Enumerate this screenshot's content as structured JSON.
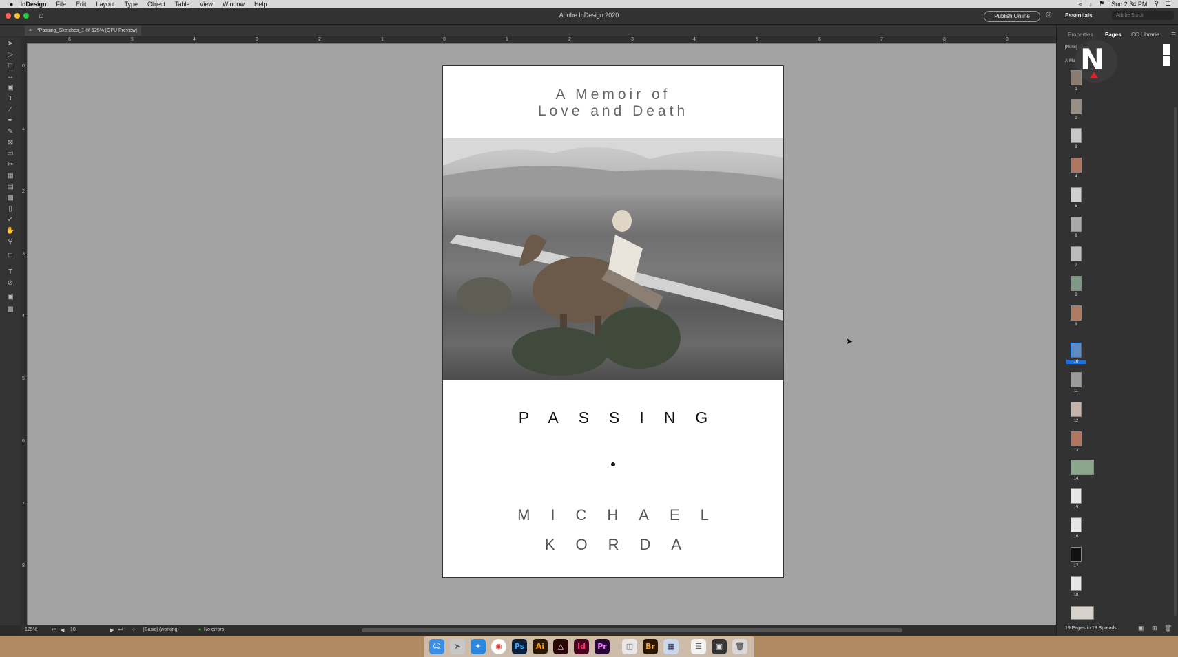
{
  "menubar": {
    "apple": "",
    "app_name": "InDesign",
    "items": [
      "File",
      "Edit",
      "Layout",
      "Type",
      "Object",
      "Table",
      "View",
      "Window",
      "Help"
    ],
    "clock": "Sun 2:34 PM"
  },
  "appbar": {
    "title": "Adobe InDesign 2020",
    "publish_label": "Publish Online",
    "workspace": "Essentials",
    "stock_placeholder": "Adobe Stock"
  },
  "document": {
    "tab_label": "*Passing_Sketches_1 @ 125% [GPU Preview]",
    "close_glyph": "×"
  },
  "rulers": {
    "top_ticks": [
      "6",
      "5",
      "4",
      "3",
      "2",
      "1",
      "0",
      "1",
      "2",
      "3",
      "4",
      "5",
      "6",
      "7",
      "8",
      "9"
    ],
    "left_ticks": [
      "0",
      "1",
      "2",
      "3",
      "4",
      "5",
      "6",
      "7",
      "8"
    ]
  },
  "cover": {
    "subtitle_line1": "A Memoir of",
    "subtitle_line2": "Love and Death",
    "title": "PASSING",
    "author_first": "MICHAEL",
    "author_last": "KORDA"
  },
  "statusbar": {
    "zoom": "125%",
    "page": "10",
    "profile": "[Basic] (working)",
    "preflight": "No errors",
    "preflight_color": "#3dbb3d"
  },
  "panel": {
    "tabs": [
      "Properties",
      "Pages",
      "CC Librarie"
    ],
    "active_tab": "Pages",
    "master_none": "[None]",
    "master_a": "A-Mast",
    "badge_letter": "N",
    "pages": [
      "1",
      "2",
      "3",
      "4",
      "5",
      "6",
      "7",
      "8",
      "9",
      "10",
      "11",
      "12",
      "13",
      "14",
      "15",
      "16",
      "17",
      "18"
    ],
    "selected_page": "10",
    "summary": "19 Pages in 19 Spreads"
  },
  "dock": {
    "apps": [
      "Finder",
      "Launchpad",
      "Safari",
      "Chrome",
      "Ps",
      "Ai",
      "Acrobat",
      "Id",
      "Pr",
      "Preview",
      "Br",
      "Image Capture",
      "Notes",
      "Screenshot",
      "Trash"
    ]
  }
}
